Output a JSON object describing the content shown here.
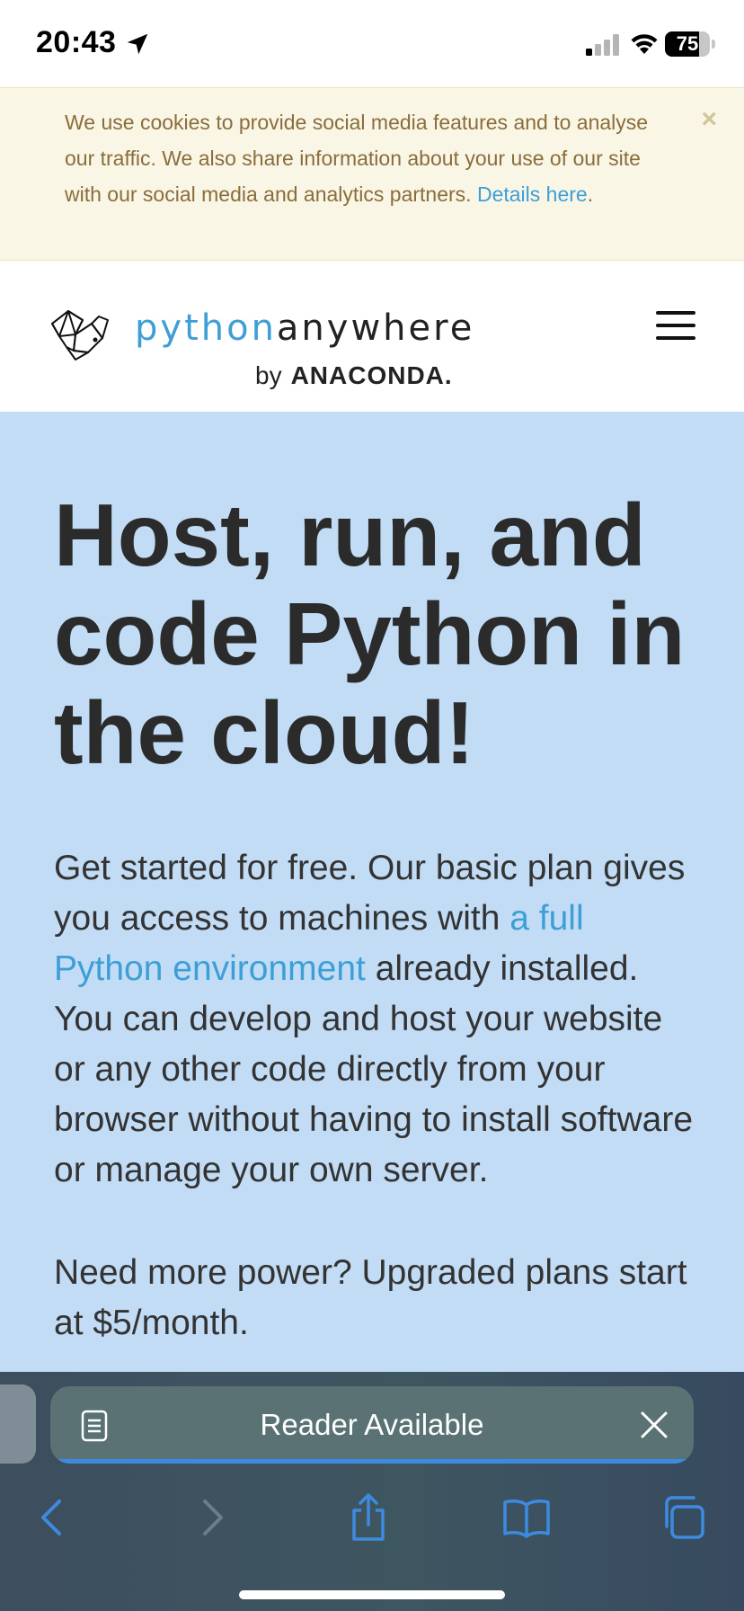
{
  "status_bar": {
    "time": "20:43",
    "battery": "75",
    "battery_level_percent": 75
  },
  "cookie_banner": {
    "text": "We use cookies to provide social media features and to analyse our traffic. We also share information about your use of our site with our social media and analytics partners. ",
    "link_text": "Details here",
    "suffix": ".",
    "close_label": "×"
  },
  "header": {
    "logo_python": "python",
    "logo_anywhere": "anywhere",
    "logo_by": "by",
    "logo_anaconda": "ANACONDA."
  },
  "hero": {
    "title": "Host, run, and code Python in the cloud!",
    "body_part1": "Get started for free. Our basic plan gives you access to machines with ",
    "body_link": "a full Python environment",
    "body_part2": " already installed. You can develop and host your website or any other code directly from your browser without having to install software or manage your own server.",
    "note": "Need more power? Upgraded plans start at $5/month."
  },
  "safari": {
    "reader_label": "Reader Available",
    "icons": {
      "reader": "reader-icon",
      "close": "close-icon",
      "back": "back-chevron-icon",
      "forward": "forward-chevron-icon",
      "share": "share-icon",
      "bookmarks": "bookmarks-icon",
      "tabs": "tabs-icon"
    }
  },
  "colors": {
    "accent": "#3d9fd6",
    "hero_bg": "#c2dcf5",
    "cookie_bg": "#faf6e6",
    "cookie_text": "#8a6d3b",
    "safari_blue": "#3d8be0"
  }
}
